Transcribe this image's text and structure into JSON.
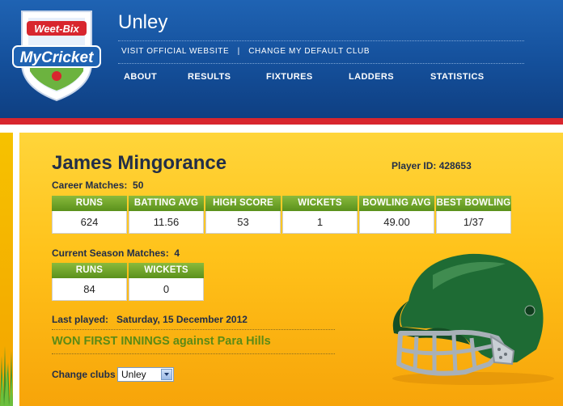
{
  "header": {
    "logo": {
      "brand_top": "Weet-Bix",
      "brand_bottom": "MyCricket"
    },
    "club_name": "Unley",
    "links": [
      "VISIT OFFICIAL WEBSITE",
      "CHANGE MY DEFAULT CLUB"
    ],
    "link_separator": "|",
    "nav": [
      "ABOUT",
      "RESULTS",
      "FIXTURES",
      "LADDERS",
      "STATISTICS"
    ]
  },
  "player": {
    "name": "James Mingorance",
    "player_id": "Player ID: 428653",
    "career_label": "Career Matches:",
    "career_matches": "50",
    "career_stats": [
      {
        "label": "RUNS",
        "value": "624"
      },
      {
        "label": "BATTING AVG",
        "value": "11.56"
      },
      {
        "label": "HIGH SCORE",
        "value": "53"
      },
      {
        "label": "WICKETS",
        "value": "1"
      },
      {
        "label": "BOWLING AVG",
        "value": "49.00"
      },
      {
        "label": "BEST BOWLING",
        "value": "1/37"
      }
    ],
    "season_label": "Current Season Matches:",
    "season_matches": "4",
    "season_stats": [
      {
        "label": "RUNS",
        "value": "84"
      },
      {
        "label": "WICKETS",
        "value": "0"
      }
    ],
    "last_played_label": "Last played:",
    "last_played_date": "Saturday, 15 December 2012",
    "last_result": "WON FIRST INNINGS against Para Hills"
  },
  "change_clubs": {
    "label": "Change clubs",
    "selected": "Unley"
  },
  "colors": {
    "header_blue": "#1f63b3",
    "accent_red": "#d8262e",
    "stat_green": "#6fa22a",
    "panel_yellow": "#ffc21a",
    "result_green": "#5b8a16"
  }
}
